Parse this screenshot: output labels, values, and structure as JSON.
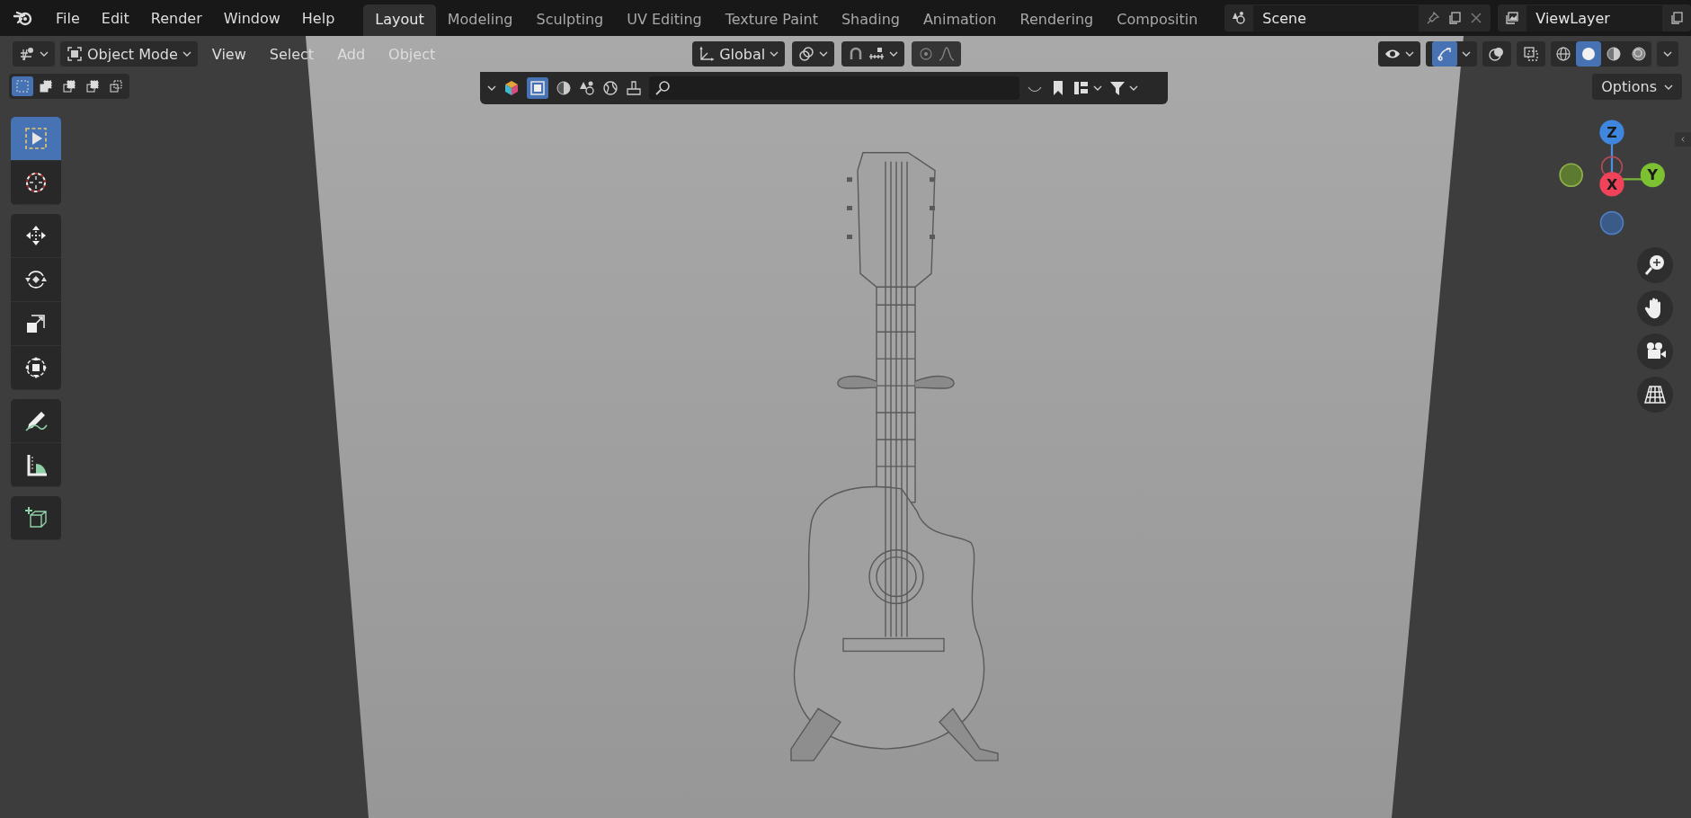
{
  "menu": [
    "File",
    "Edit",
    "Render",
    "Window",
    "Help"
  ],
  "workspaces": [
    {
      "label": "Layout",
      "selected": true
    },
    {
      "label": "Modeling",
      "selected": false
    },
    {
      "label": "Sculpting",
      "selected": false
    },
    {
      "label": "UV Editing",
      "selected": false
    },
    {
      "label": "Texture Paint",
      "selected": false
    },
    {
      "label": "Shading",
      "selected": false
    },
    {
      "label": "Animation",
      "selected": false
    },
    {
      "label": "Rendering",
      "selected": false
    },
    {
      "label": "Compositin",
      "selected": false
    }
  ],
  "scene": {
    "value": "Scene"
  },
  "view_layer": {
    "value": "ViewLayer"
  },
  "header": {
    "mode": "Object Mode",
    "menus": [
      "View",
      "Select",
      "Add",
      "Object"
    ],
    "orientation": "Global",
    "gizmo_toggle": {
      "on": true
    }
  },
  "shading": [
    {
      "kind": "wireframe",
      "selected": false
    },
    {
      "kind": "solid",
      "selected": true
    },
    {
      "kind": "material",
      "selected": false
    },
    {
      "kind": "rendered",
      "selected": false
    }
  ],
  "select_modes": [
    {
      "kind": "new",
      "selected": true
    },
    {
      "kind": "extend",
      "selected": false
    },
    {
      "kind": "subtract",
      "selected": false
    },
    {
      "kind": "invert",
      "selected": false
    },
    {
      "kind": "intersect",
      "selected": false
    }
  ],
  "options": "Options",
  "tool_groups": [
    [
      {
        "kind": "select",
        "selected": true
      },
      {
        "kind": "cursor",
        "selected": false
      }
    ],
    [
      {
        "kind": "move",
        "selected": false
      },
      {
        "kind": "rotate",
        "selected": false
      },
      {
        "kind": "scale",
        "selected": false
      },
      {
        "kind": "transform",
        "selected": false
      }
    ],
    [
      {
        "kind": "annotate",
        "selected": false
      },
      {
        "kind": "measure",
        "selected": false
      }
    ],
    [
      {
        "kind": "add_cube",
        "selected": false
      }
    ]
  ],
  "gizmo": {
    "z": "Z",
    "x": "X",
    "y": "Y"
  }
}
